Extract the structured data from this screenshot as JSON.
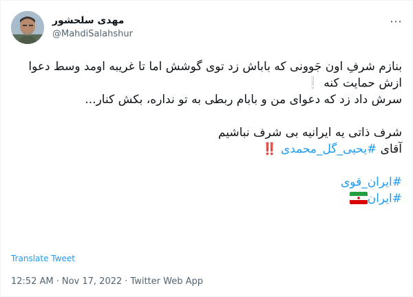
{
  "author": {
    "display_name": "مهدی سلحشور",
    "handle": "@MahdiSalahshur"
  },
  "tweet": {
    "line1": "بنازم شرفِ اون جَوونی که باباش زد توی گوشش اما تا غریبه اومد وسط دعوا ازش حمایت کنه ❕",
    "line2": "سرش داد زد که دعوای من و بابام ربطی به تو نداره، بکش کنار...",
    "line3": "شرف ذاتی یه ایرانیه بی شرف نباشیم",
    "line4_prefix": "آقای ",
    "line4_hashtag": "#یحیی_گل_محمدی",
    "line4_suffix": " ‼️",
    "hashtag1": "#ایران_قوی",
    "hashtag2": "#ایران",
    "flag_emoji": "iran-flag"
  },
  "translate_label": "Translate Tweet",
  "meta": {
    "time": "12:52 AM",
    "separator": "·",
    "date": "Nov 17, 2022",
    "source": "Twitter Web App"
  },
  "colors": {
    "link": "#1d9bf0",
    "secondary_text": "#536471",
    "primary_text": "#0f1419"
  }
}
